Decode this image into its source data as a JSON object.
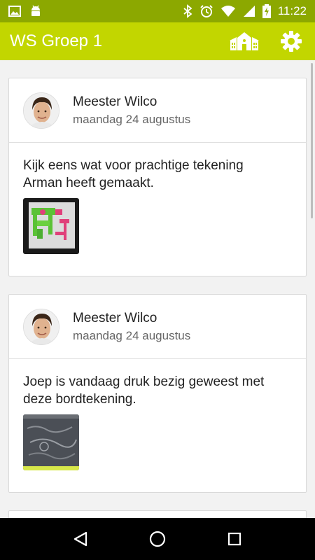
{
  "status_bar": {
    "time": "11:22"
  },
  "app_bar": {
    "title": "WS Groep 1"
  },
  "posts": [
    {
      "author": "Meester Wilco",
      "date": "maandag 24 augustus",
      "text": "Kijk eens wat voor prachtige tekening Arman heeft gemaakt."
    },
    {
      "author": "Meester Wilco",
      "date": "maandag 24 augustus",
      "text": "Joep is vandaag druk bezig geweest met deze bordtekening."
    }
  ],
  "colors": {
    "status_bar": "#8ca800",
    "app_bar": "#c2d600",
    "nav_bar": "#000000"
  },
  "icons": {
    "app_bar": [
      "school-icon",
      "gear-icon"
    ],
    "nav_bar": [
      "back-icon",
      "home-icon",
      "recents-icon"
    ]
  }
}
